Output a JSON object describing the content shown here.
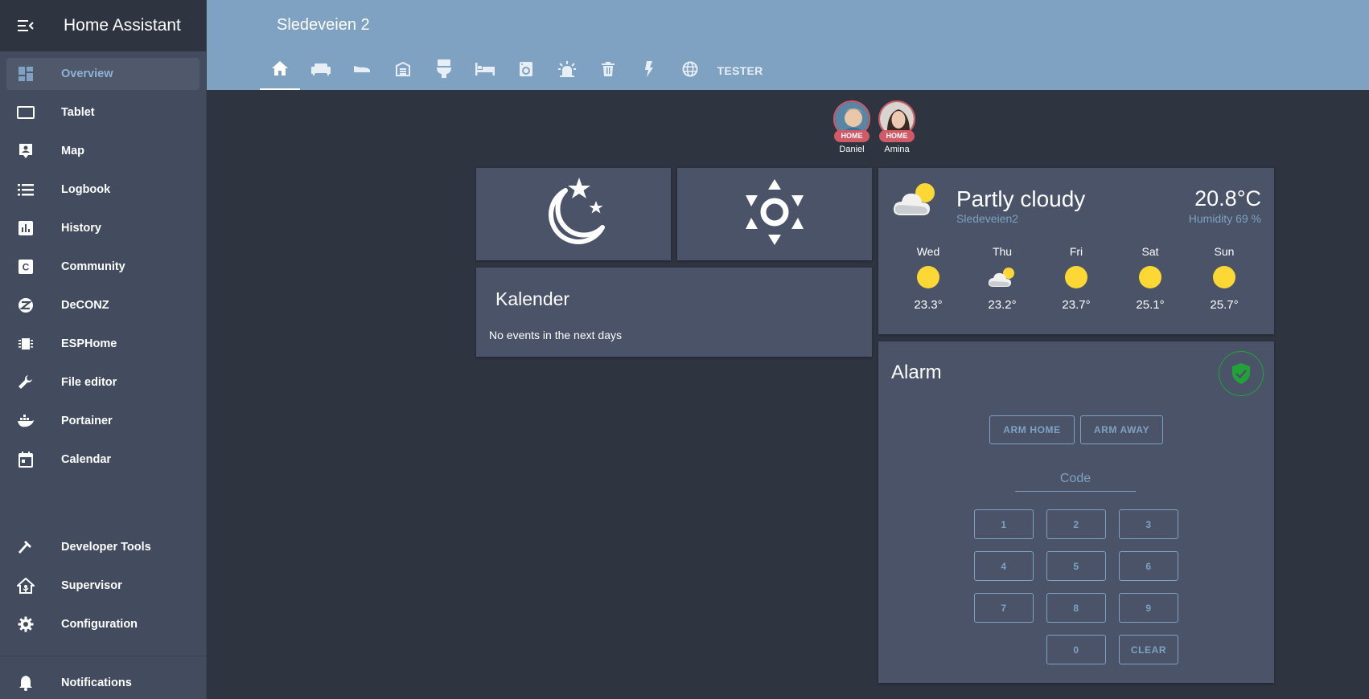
{
  "app": {
    "title": "Home Assistant"
  },
  "sidebar": {
    "items": [
      {
        "label": "Overview",
        "icon": "view-dashboard-icon",
        "active": true
      },
      {
        "label": "Tablet",
        "icon": "tablet-icon"
      },
      {
        "label": "Map",
        "icon": "map-account-icon"
      },
      {
        "label": "Logbook",
        "icon": "format-list-bulleted-icon"
      },
      {
        "label": "History",
        "icon": "chart-box-icon"
      },
      {
        "label": "Community",
        "icon": "alpha-c-box-icon"
      },
      {
        "label": "DeCONZ",
        "icon": "zigbee-icon"
      },
      {
        "label": "ESPHome",
        "icon": "chip-icon"
      },
      {
        "label": "File editor",
        "icon": "wrench-icon"
      },
      {
        "label": "Portainer",
        "icon": "docker-icon"
      },
      {
        "label": "Calendar",
        "icon": "calendar-icon"
      },
      {
        "label": "Developer Tools",
        "icon": "hammer-icon"
      },
      {
        "label": "Supervisor",
        "icon": "home-assistant-icon"
      },
      {
        "label": "Configuration",
        "icon": "cog-icon"
      },
      {
        "label": "Notifications",
        "icon": "bell-icon"
      }
    ]
  },
  "header": {
    "title": "Sledeveien 2",
    "tabs": [
      "home-icon",
      "sofa-icon",
      "shoe-icon",
      "garage-icon",
      "toilet-icon",
      "bed-icon",
      "washing-machine-icon",
      "alarm-light-icon",
      "trash-can-icon",
      "flash-icon",
      "web-icon"
    ],
    "tab_text": "TESTER"
  },
  "badges": [
    {
      "name": "Daniel",
      "state": "HOME"
    },
    {
      "name": "Amina",
      "state": "HOME"
    }
  ],
  "scene_buttons": [
    {
      "icon": "weather-night-icon"
    },
    {
      "icon": "brightness-icon"
    }
  ],
  "calendar": {
    "title": "Kalender",
    "empty_text": "No events in the next days"
  },
  "weather": {
    "condition": "Partly cloudy",
    "location": "Sledeveien2",
    "temperature": "20.8°C",
    "humidity": "Humidity 69 %",
    "forecast": [
      {
        "day": "Wed",
        "temp": "23.3°",
        "icon": "sunny"
      },
      {
        "day": "Thu",
        "temp": "23.2°",
        "icon": "partlycloudy"
      },
      {
        "day": "Fri",
        "temp": "23.7°",
        "icon": "sunny"
      },
      {
        "day": "Sat",
        "temp": "25.1°",
        "icon": "sunny"
      },
      {
        "day": "Sun",
        "temp": "25.7°",
        "icon": "sunny"
      }
    ]
  },
  "alarm": {
    "title": "Alarm",
    "state_icon": "shield-check-icon",
    "arm_home": "ARM HOME",
    "arm_away": "ARM AWAY",
    "code_placeholder": "Code",
    "keys": [
      "1",
      "2",
      "3",
      "4",
      "5",
      "6",
      "7",
      "8",
      "9",
      "0",
      "CLEAR"
    ]
  },
  "colors": {
    "header": "#7fa2c2",
    "sidebar": "#434c5e",
    "card": "#4a5367",
    "badge": "#d05a66",
    "sun": "#fdd835",
    "armed": "#22a33a"
  }
}
